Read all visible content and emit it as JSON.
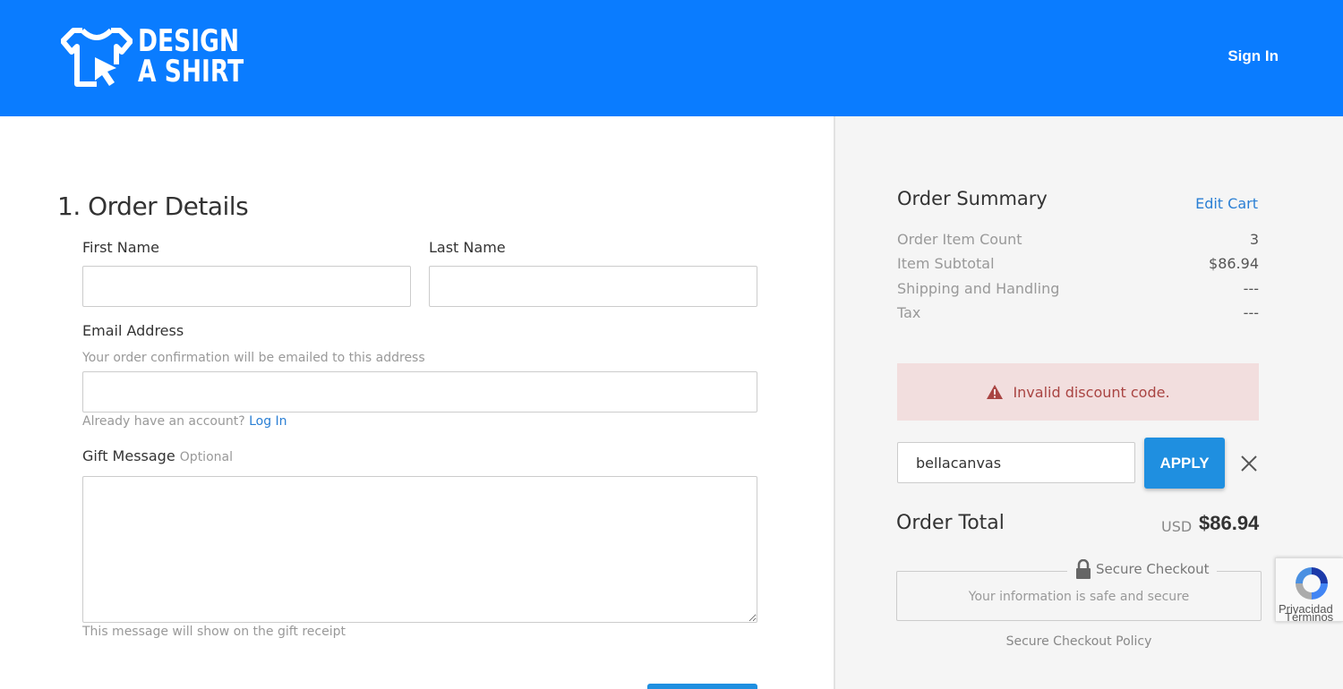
{
  "header": {
    "logo_line1": "DESIGN",
    "logo_line2": "A SHIRT",
    "signin_label": "Sign In",
    "bg_color": "#0a7cff"
  },
  "order_details": {
    "title": "1. Order Details",
    "first_name_label": "First Name",
    "first_name_value": "",
    "last_name_label": "Last Name",
    "last_name_value": "",
    "email_label": "Email Address",
    "email_hint": "Your order confirmation will be emailed to this address",
    "email_value": "",
    "account_prompt": "Already have an account?",
    "login_link": "Log In",
    "gift_label": "Gift Message",
    "gift_optional": "Optional",
    "gift_value": "",
    "gift_hint": "This message will show on the gift receipt"
  },
  "summary": {
    "title": "Order Summary",
    "edit_cart": "Edit Cart",
    "rows": [
      {
        "label": "Order Item Count",
        "value": "3"
      },
      {
        "label": "Item Subtotal",
        "value": "$86.94"
      },
      {
        "label": "Shipping and Handling",
        "value": "---"
      },
      {
        "label": "Tax",
        "value": "---"
      }
    ],
    "alert": "Invalid discount code.",
    "discount_code": "bellacanvas",
    "apply_label": "APPLY",
    "total_label": "Order Total",
    "currency": "USD",
    "total_value": "$86.94",
    "secure_title": "Secure Checkout",
    "secure_sub": "Your information is safe and secure",
    "secure_policy": "Secure Checkout Policy"
  },
  "recaptcha": {
    "privacy": "Privacidad",
    "terms": "Términos"
  }
}
